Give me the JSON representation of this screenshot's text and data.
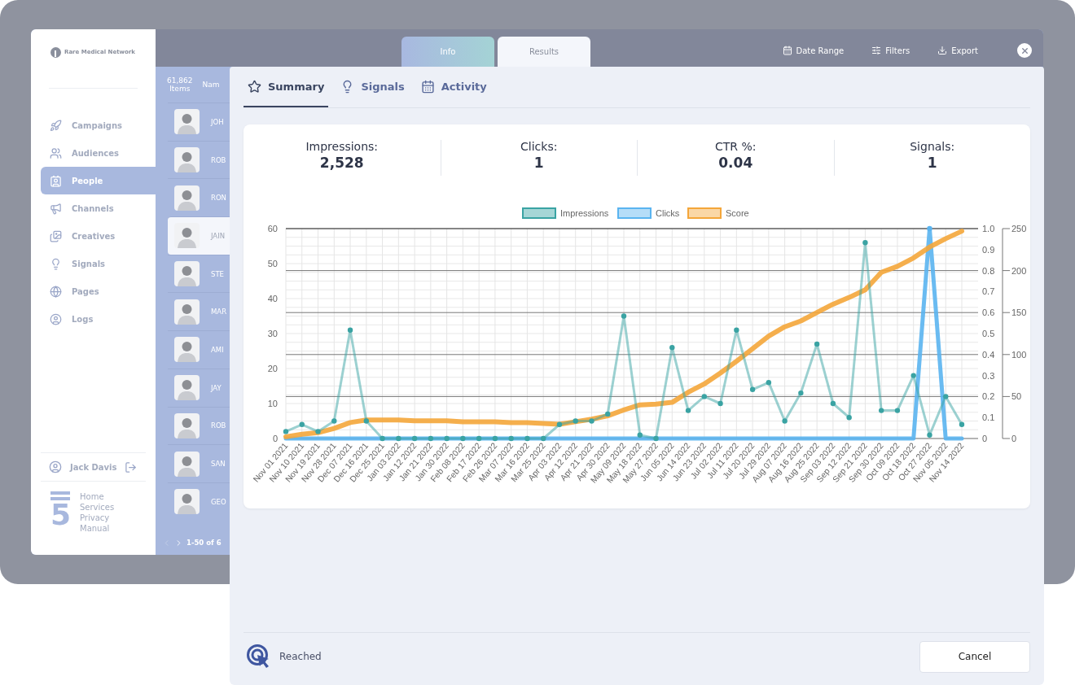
{
  "sidebar": {
    "logo_text": "Rare Medical Network",
    "items": [
      {
        "label": "Campaigns",
        "selected": false
      },
      {
        "label": "Audiences",
        "selected": false
      },
      {
        "label": "People",
        "selected": true
      },
      {
        "label": "Channels",
        "selected": false
      },
      {
        "label": "Creatives",
        "selected": false
      },
      {
        "label": "Signals",
        "selected": false
      },
      {
        "label": "Pages",
        "selected": false
      },
      {
        "label": "Logs",
        "selected": false
      }
    ],
    "user": "Jack Davis",
    "brand_mark": "5",
    "footer_links": [
      "Home",
      "Services",
      "Privacy",
      "Manual"
    ]
  },
  "top_tabs": [
    {
      "label": "Info",
      "selected": false
    },
    {
      "label": "Results",
      "selected": true
    }
  ],
  "toolbar": [
    "Date Range",
    "Filters",
    "Export"
  ],
  "people_list": {
    "count": "61,862",
    "count_unit": "Items",
    "column_1": "Nam",
    "rows": [
      {
        "name": "JOH",
        "selected": false
      },
      {
        "name": "ROB",
        "selected": false
      },
      {
        "name": "RON",
        "selected": false
      },
      {
        "name": "JAIN",
        "selected": true
      },
      {
        "name": "STE",
        "selected": false
      },
      {
        "name": "MAR",
        "selected": false
      },
      {
        "name": "AMI",
        "selected": false
      },
      {
        "name": "JAY",
        "selected": false
      },
      {
        "name": "ROB",
        "selected": false
      },
      {
        "name": "SAN",
        "selected": false
      },
      {
        "name": "GEO",
        "selected": false
      }
    ],
    "pagination": "1-50 of 6"
  },
  "modal": {
    "tabs": [
      {
        "label": "Summary",
        "selected": true
      },
      {
        "label": "Signals",
        "selected": false
      },
      {
        "label": "Activity",
        "selected": false
      }
    ],
    "stats": [
      {
        "label": "Impressions:",
        "value": "2,528"
      },
      {
        "label": "Clicks:",
        "value": "1"
      },
      {
        "label": "CTR %:",
        "value": "0.04"
      },
      {
        "label": "Signals:",
        "value": "1"
      }
    ],
    "chart_data": {
      "type": "line",
      "categories": [
        "Nov 01 2021",
        "Nov 10 2021",
        "Nov 19 2021",
        "Nov 28 2021",
        "Dec 07 2021",
        "Dec 16 2021",
        "Dec 25 2021",
        "Jan 03 2022",
        "Jan 12 2022",
        "Jan 21 2022",
        "Jan 30 2022",
        "Feb 08 2022",
        "Feb 17 2022",
        "Feb 26 2022",
        "Mar 07 2022",
        "Mar 16 2022",
        "Mar 25 2022",
        "Apr 03 2022",
        "Apr 12 2022",
        "Apr 21 2022",
        "Apr 30 2022",
        "May 09 2022",
        "May 18 2022",
        "May 27 2022",
        "Jun 05 2022",
        "Jun 14 2022",
        "Jun 23 2022",
        "Jul 02 2022",
        "Jul 11 2022",
        "Jul 20 2022",
        "Jul 29 2022",
        "Aug 07 2022",
        "Aug 16 2022",
        "Aug 25 2022",
        "Sep 03 2022",
        "Sep 12 2022",
        "Sep 21 2022",
        "Sep 30 2022",
        "Oct 09 2022",
        "Oct 18 2022",
        "Oct 27 2022",
        "Nov 05 2022",
        "Nov 14 2022"
      ],
      "series": [
        {
          "name": "Impressions",
          "color": "#3aa3a3",
          "marker": "circle",
          "values": [
            2,
            4,
            2,
            5,
            31,
            5,
            0,
            0,
            0,
            0,
            0,
            0,
            0,
            0,
            0,
            0,
            0,
            4,
            5,
            5,
            7,
            35,
            1,
            0,
            26,
            8,
            12,
            10,
            31,
            14,
            16,
            5,
            13,
            27,
            10,
            6,
            56,
            8,
            8,
            18,
            1,
            12,
            4
          ]
        },
        {
          "name": "Clicks",
          "color": "#5ab4f0",
          "axis": "y2",
          "values": [
            0,
            0,
            0,
            0,
            0,
            0,
            0,
            0,
            0,
            0,
            0,
            0,
            0,
            0,
            0,
            0,
            0,
            0,
            0,
            0,
            0,
            0,
            0,
            0,
            0,
            0,
            0,
            0,
            0,
            0,
            0,
            0,
            0,
            0,
            0,
            0,
            0,
            0,
            0,
            0,
            1,
            0,
            0
          ]
        },
        {
          "name": "Score",
          "color": "#f4a63a",
          "axis": "y3",
          "values": [
            2,
            5,
            7,
            12,
            19,
            22,
            22,
            22,
            21,
            21,
            21,
            20,
            20,
            20,
            19,
            19,
            18,
            17,
            20,
            23,
            27,
            34,
            40,
            41,
            43,
            55,
            65,
            78,
            92,
            107,
            122,
            133,
            140,
            150,
            160,
            168,
            177,
            198,
            205,
            215,
            228,
            238,
            247
          ]
        }
      ],
      "grid": true,
      "legend": "top",
      "ylim": [
        0,
        60
      ],
      "yticks": [
        0,
        10,
        20,
        30,
        40,
        50,
        60
      ],
      "y2lim": [
        0,
        1
      ],
      "y2ticks": [
        {
          "value": 0,
          "label": "0"
        },
        {
          "value": 0.1,
          "label": "0.1"
        },
        {
          "value": 0.2,
          "label": "0.2"
        },
        {
          "value": 0.3,
          "label": "0.3"
        },
        {
          "value": 0.4,
          "label": "0.4"
        },
        {
          "value": 0.5,
          "label": "0.5"
        },
        {
          "value": 0.6,
          "label": "0.6"
        },
        {
          "value": 0.7,
          "label": "0.7"
        },
        {
          "value": 0.8,
          "label": "0.8"
        },
        {
          "value": 0.9,
          "label": "0.9"
        },
        {
          "value": 1,
          "label": "1.0"
        }
      ],
      "y3lim": [
        0,
        250
      ],
      "y3ticks": [
        0,
        50,
        100,
        150,
        200,
        250
      ]
    },
    "footer_status": "Reached",
    "cancel": "Cancel"
  }
}
